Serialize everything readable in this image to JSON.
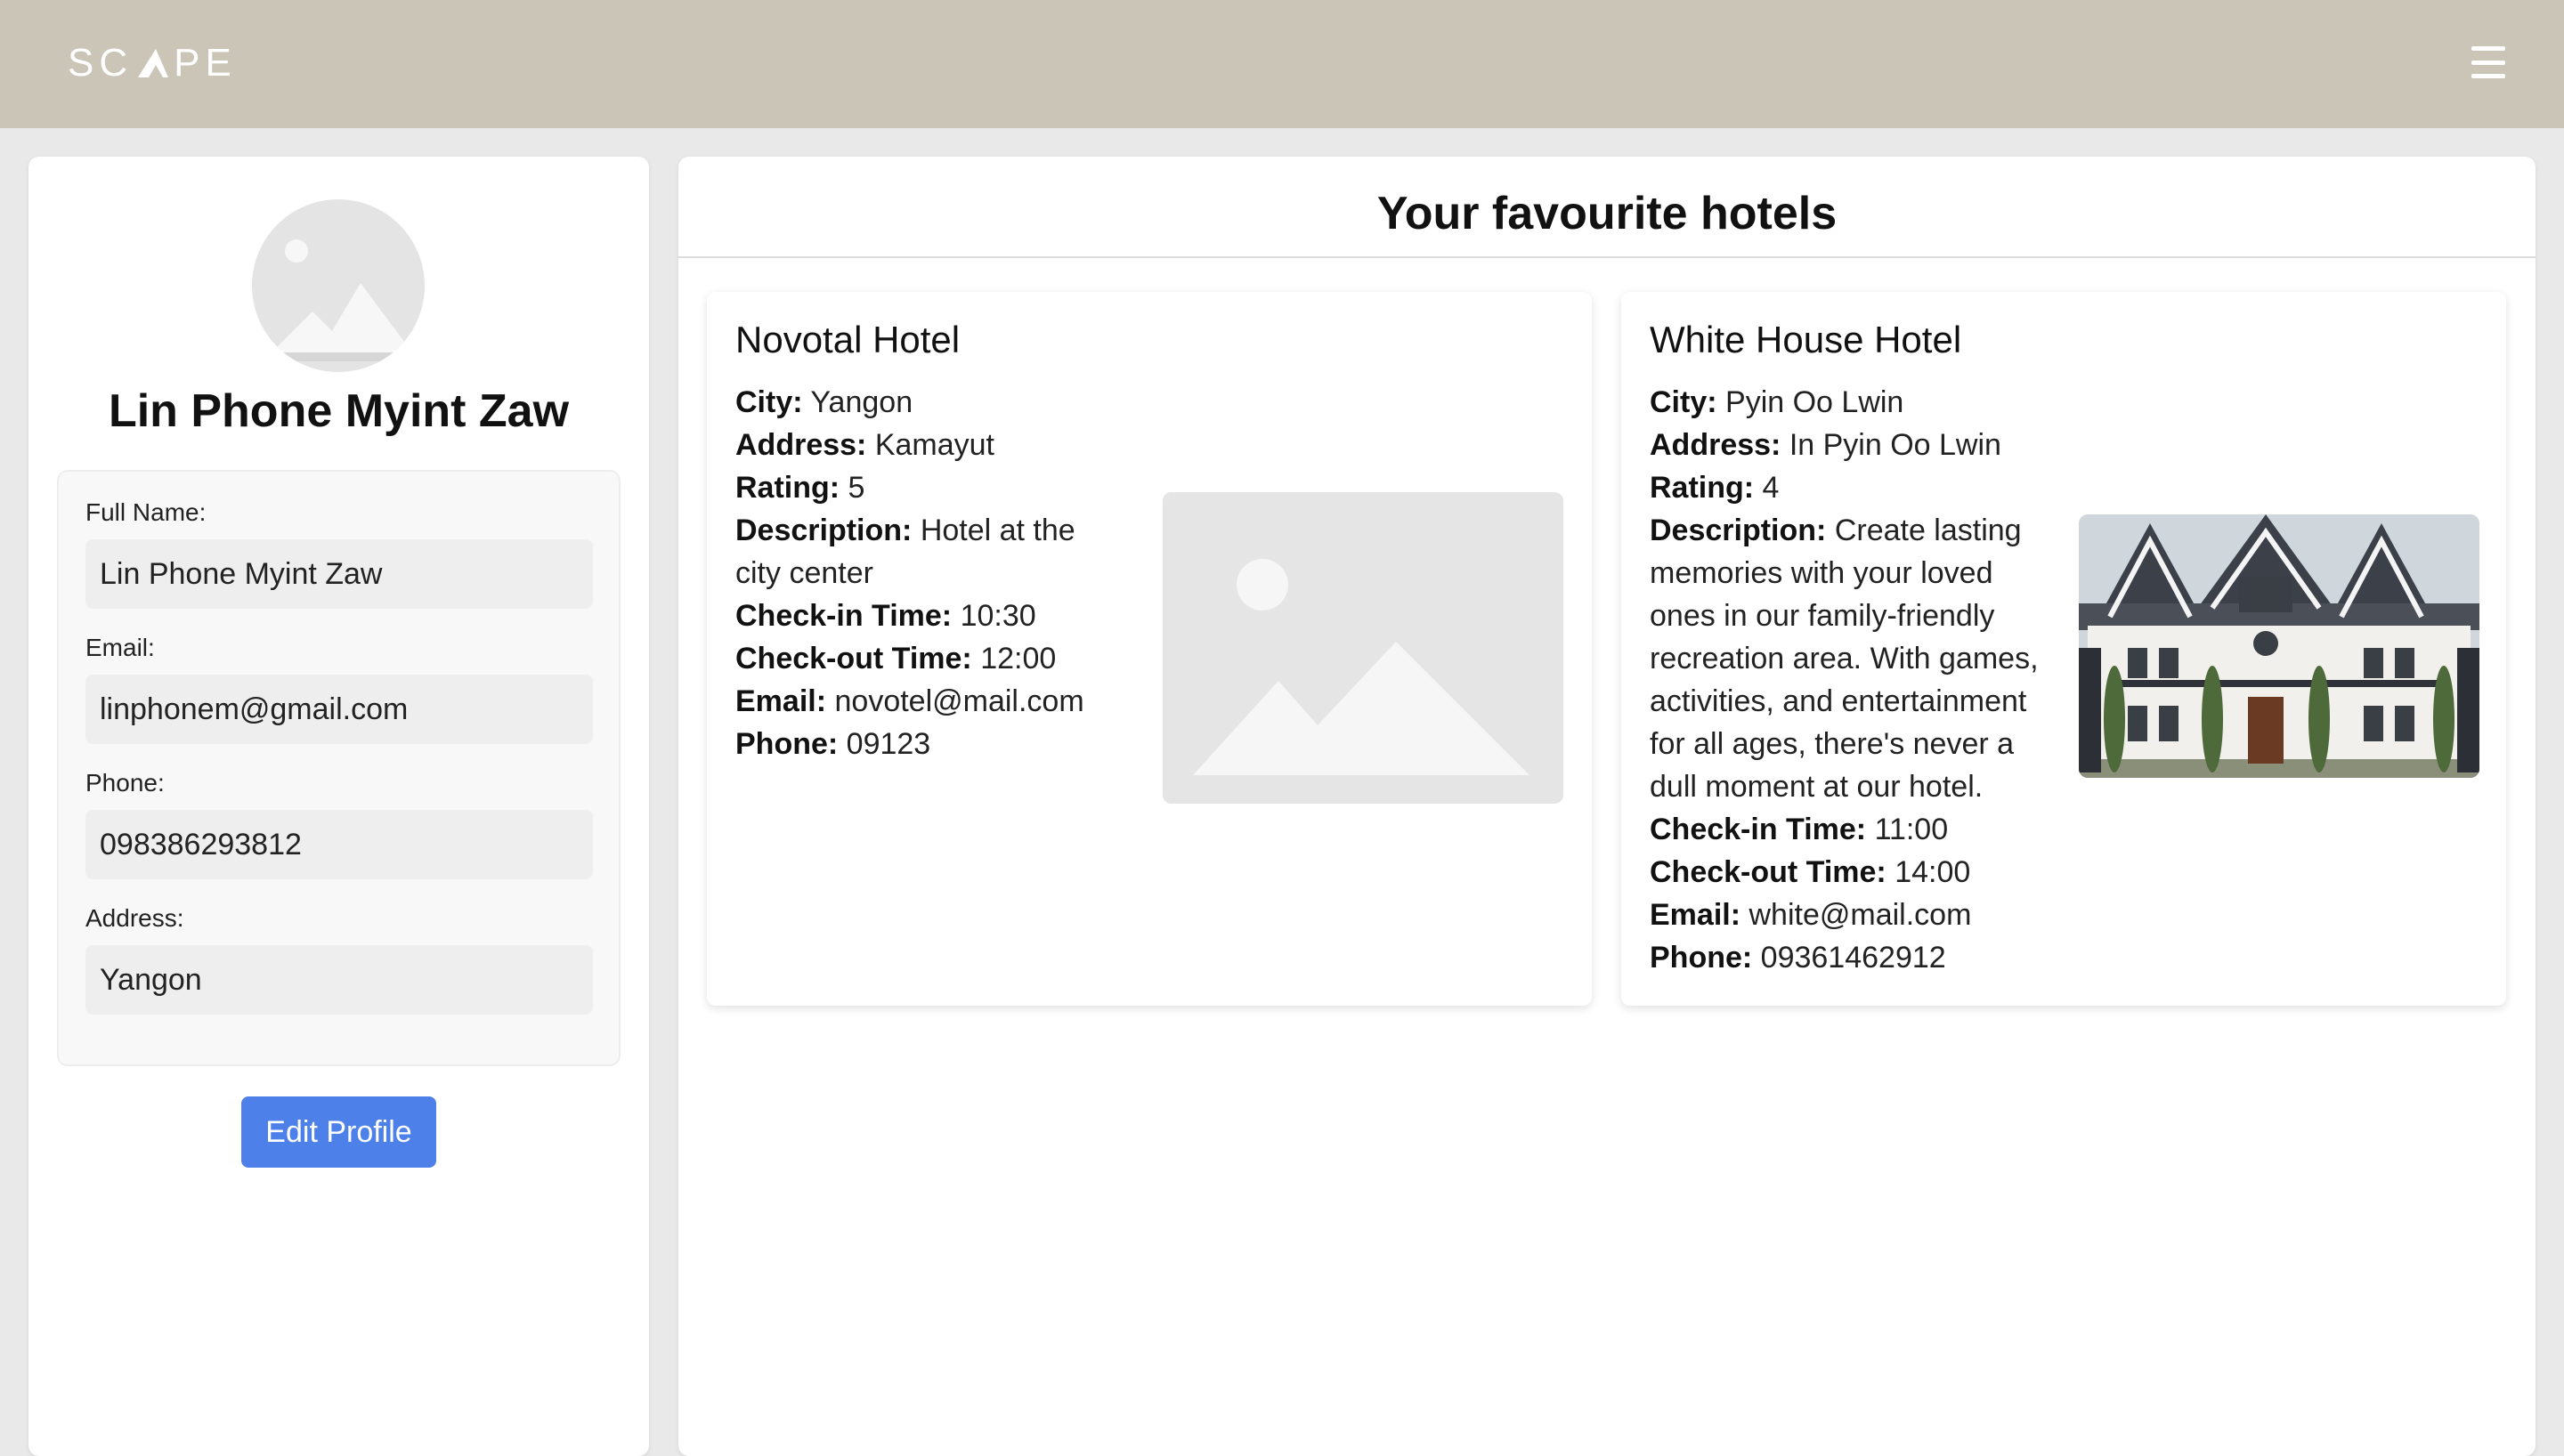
{
  "header": {
    "logo_text_left": "SC",
    "logo_text_right": "PE",
    "menu_icon": "hamburger-icon",
    "background": "#cbc5b8"
  },
  "profile": {
    "avatar_icon": "image-placeholder-icon",
    "name": "Lin Phone Myint Zaw",
    "fields": [
      {
        "label": "Full Name:",
        "value": "Lin Phone Myint Zaw"
      },
      {
        "label": "Email:",
        "value": "linphonem@gmail.com"
      },
      {
        "label": "Phone:",
        "value": "098386293812"
      },
      {
        "label": "Address:",
        "value": "Yangon"
      }
    ],
    "edit_button": "Edit Profile",
    "accent": "#4d80e8"
  },
  "favourites": {
    "title": "Your favourite hotels",
    "hotels": [
      {
        "name": "Novotal Hotel",
        "city_label": "City:",
        "city": "Yangon",
        "address_label": "Address:",
        "address": "Kamayut",
        "rating_label": "Rating:",
        "rating": "5",
        "description_label": "Description:",
        "description": "Hotel at the city center",
        "checkin_label": "Check-in Time:",
        "checkin": "10:30",
        "checkout_label": "Check-out Time:",
        "checkout": "12:00",
        "email_label": "Email:",
        "email": "novotel@mail.com",
        "phone_label": "Phone:",
        "phone": "09123",
        "image": "image-placeholder-icon"
      },
      {
        "name": "White House Hotel",
        "city_label": "City:",
        "city": "Pyin Oo Lwin",
        "address_label": "Address:",
        "address": "In Pyin Oo Lwin",
        "rating_label": "Rating:",
        "rating": "4",
        "description_label": "Description:",
        "description": "Create lasting memories with your loved ones in our family-friendly recreation area. With games, activities, and entertainment for all ages, there's never a dull moment at our hotel.",
        "checkin_label": "Check-in Time:",
        "checkin": "11:00",
        "checkout_label": "Check-out Time:",
        "checkout": "14:00",
        "email_label": "Email:",
        "email": "white@mail.com",
        "phone_label": "Phone:",
        "phone": "09361462912",
        "image": "hotel-photo"
      }
    ]
  }
}
